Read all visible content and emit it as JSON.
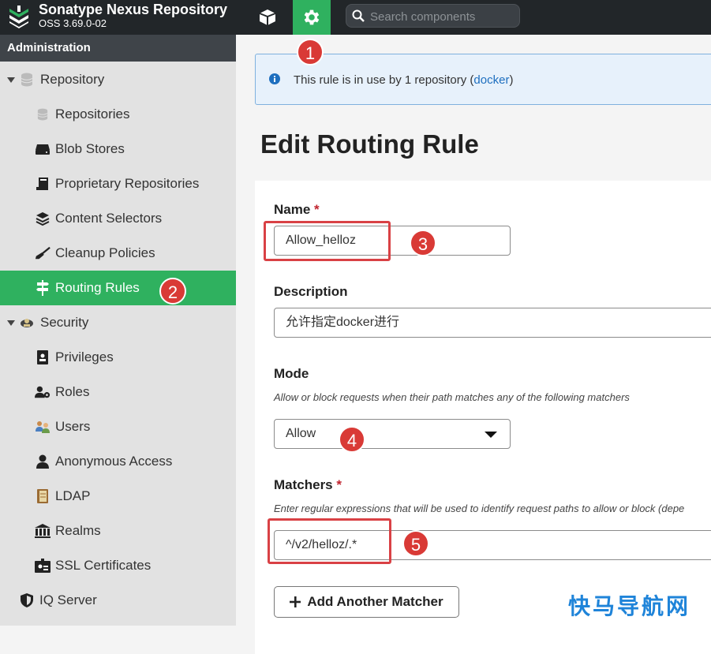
{
  "header": {
    "title": "Sonatype Nexus Repository",
    "version": "OSS 3.69.0-02",
    "search_placeholder": "Search components"
  },
  "sidebar": {
    "section_title": "Administration",
    "items": [
      {
        "label": "Repository",
        "icon": "database-icon"
      },
      {
        "label": "Repositories",
        "icon": "database-icon"
      },
      {
        "label": "Blob Stores",
        "icon": "hdd-icon"
      },
      {
        "label": "Proprietary Repositories",
        "icon": "book-icon"
      },
      {
        "label": "Content Selectors",
        "icon": "layers-icon"
      },
      {
        "label": "Cleanup Policies",
        "icon": "broom-icon"
      },
      {
        "label": "Routing Rules",
        "icon": "signpost-icon",
        "active": true
      },
      {
        "label": "Security",
        "icon": "security-icon"
      },
      {
        "label": "Privileges",
        "icon": "id-badge-icon"
      },
      {
        "label": "Roles",
        "icon": "user-gear-icon"
      },
      {
        "label": "Users",
        "icon": "users-icon"
      },
      {
        "label": "Anonymous Access",
        "icon": "user-icon"
      },
      {
        "label": "LDAP",
        "icon": "address-book-icon"
      },
      {
        "label": "Realms",
        "icon": "building-icon"
      },
      {
        "label": "SSL Certificates",
        "icon": "certificate-icon"
      },
      {
        "label": "IQ Server",
        "icon": "shield-icon"
      }
    ]
  },
  "banner": {
    "text_before": "This rule is in use by 1 repository (",
    "link": "docker",
    "text_after": ")"
  },
  "page_title": "Edit Routing Rule",
  "form": {
    "name_label": "Name",
    "required_mark": "*",
    "name_value": "Allow_helloz",
    "description_label": "Description",
    "description_value": "允许指定docker进行",
    "mode_label": "Mode",
    "mode_help": "Allow or block requests when their path matches any of the following matchers",
    "mode_value": "Allow",
    "matchers_label": "Matchers",
    "matchers_help": "Enter regular expressions that will be used to identify request paths to allow or block (depe",
    "matcher_value": "^/v2/helloz/.*",
    "add_matcher_label": "Add Another Matcher"
  },
  "annotations": [
    "1",
    "2",
    "3",
    "4",
    "5"
  ],
  "watermark": "快马导航网",
  "colors": {
    "topbar": "#222629",
    "accent_green": "#2fb15f",
    "sidebar_header": "#3f4449",
    "annotation_red": "#d93a36",
    "banner_bg": "#e7f1fb",
    "link_blue": "#1e6fbf"
  }
}
